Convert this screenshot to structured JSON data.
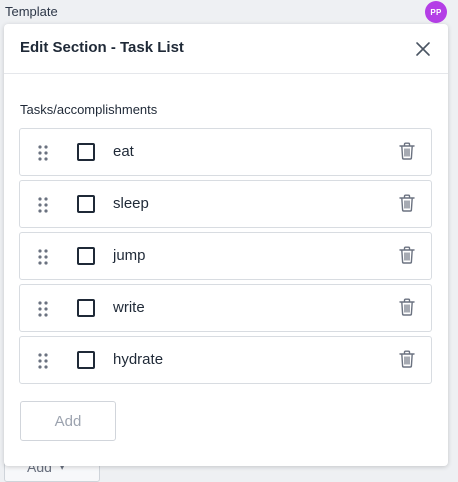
{
  "background": {
    "title": "Template",
    "avatar_initials": "PP",
    "add_label": "Add",
    "add_caret": "▾"
  },
  "modal": {
    "title": "Edit Section - Task List",
    "section_label": "Tasks/accomplishments",
    "tasks": [
      {
        "label": "eat",
        "checked": false
      },
      {
        "label": "sleep",
        "checked": false
      },
      {
        "label": "jump",
        "checked": false
      },
      {
        "label": "write",
        "checked": false
      },
      {
        "label": "hydrate",
        "checked": false
      }
    ],
    "add_label": "Add"
  },
  "colors": {
    "avatar": "#b43ee6",
    "border": "#d8dce1",
    "text": "#1f2937"
  }
}
